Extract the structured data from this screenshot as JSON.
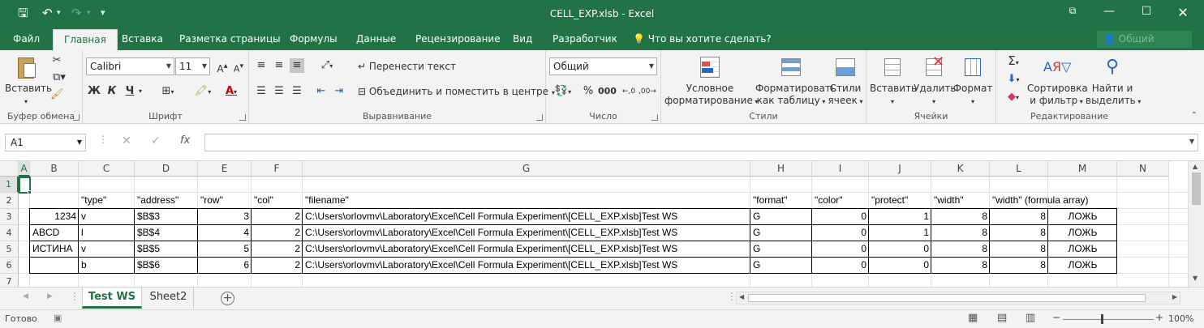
{
  "window": {
    "title": "CELL_EXP.xlsb - Excel"
  },
  "tabs": [
    "Файл",
    "Главная",
    "Вставка",
    "Разметка страницы",
    "Формулы",
    "Данные",
    "Рецензирование",
    "Вид",
    "Разработчик"
  ],
  "tell_me": "Что вы хотите сделать?",
  "sign_in": "Общий доступ",
  "ribbon": {
    "clipboard": {
      "label": "Буфер обмена",
      "paste": "Вставить"
    },
    "font": {
      "label": "Шрифт",
      "name": "Calibri",
      "size": "11",
      "bold": "Ж",
      "italic": "К",
      "underline": "Ч"
    },
    "alignment": {
      "label": "Выравнивание",
      "wrap": "Перенести текст",
      "merge": "Объединить и поместить в центре"
    },
    "number": {
      "label": "Число",
      "format": "Общий"
    },
    "styles": {
      "label": "Стили",
      "cond1": "Условное",
      "cond2": "форматирование",
      "table1": "Форматировать",
      "table2": "как таблицу",
      "cell1": "Стили",
      "cell2": "ячеек"
    },
    "cells": {
      "label": "Ячейки",
      "insert": "Вставить",
      "delete": "Удалить",
      "format": "Формат"
    },
    "editing": {
      "label": "Редактирование",
      "sort1": "Сортировка",
      "sort2": "и фильтр",
      "find1": "Найти и",
      "find2": "выделить"
    }
  },
  "formula_bar": {
    "name_box": "A1",
    "fx": "fx",
    "value": ""
  },
  "columns": [
    "A",
    "B",
    "C",
    "D",
    "E",
    "F",
    "G",
    "H",
    "I",
    "J",
    "K",
    "L",
    "M",
    "N"
  ],
  "rows": [
    "1",
    "2",
    "3",
    "4",
    "5",
    "6",
    "7"
  ],
  "header_row": [
    "",
    "\"type\"",
    "\"address\"",
    "\"row\"",
    "\"col\"",
    "\"filename\"",
    "\"format\"",
    "\"color\"",
    "\"protect\"",
    "\"width\"",
    "\"width\" (formula array)"
  ],
  "data_rows": [
    [
      "1234",
      "v",
      "$B$3",
      "3",
      "2",
      "C:\\Users\\orlovmv\\Laboratory\\Excel\\Cell Formula Experiment\\[CELL_EXP.xlsb]Test WS",
      "G",
      "0",
      "1",
      "8",
      "8",
      "ЛОЖЬ"
    ],
    [
      "ABCD",
      "l",
      "$B$4",
      "4",
      "2",
      "C:\\Users\\orlovmv\\Laboratory\\Excel\\Cell Formula Experiment\\[CELL_EXP.xlsb]Test WS",
      "G",
      "0",
      "1",
      "8",
      "8",
      "ЛОЖЬ"
    ],
    [
      "ИСТИНА",
      "v",
      "$B$5",
      "5",
      "2",
      "C:\\Users\\orlovmv\\Laboratory\\Excel\\Cell Formula Experiment\\[CELL_EXP.xlsb]Test WS",
      "G",
      "0",
      "0",
      "8",
      "8",
      "ЛОЖЬ"
    ],
    [
      "",
      "b",
      "$B$6",
      "6",
      "2",
      "C:\\Users\\orlovmv\\Laboratory\\Excel\\Cell Formula Experiment\\[CELL_EXP.xlsb]Test WS",
      "G",
      "0",
      "0",
      "8",
      "8",
      "ЛОЖЬ"
    ]
  ],
  "sheets": [
    "Test WS",
    "Sheet2"
  ],
  "status": {
    "ready": "Готово",
    "zoom": "100%"
  }
}
